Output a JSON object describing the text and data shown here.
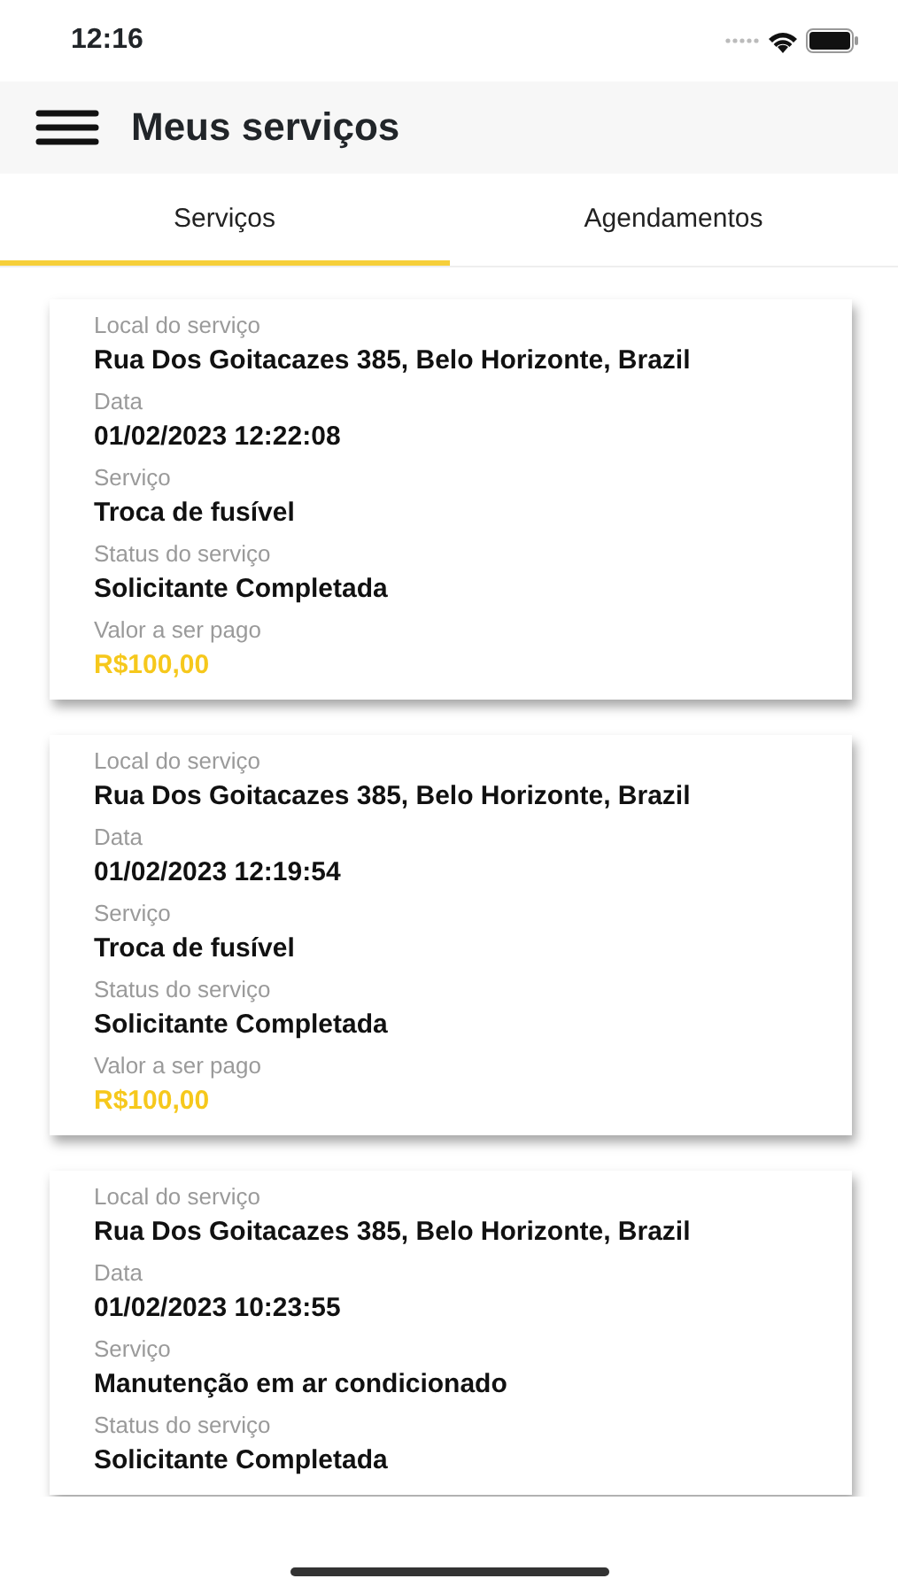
{
  "status_bar": {
    "time": "12:16"
  },
  "header": {
    "title": "Meus serviços"
  },
  "tabs": [
    {
      "label": "Serviços",
      "selected": true
    },
    {
      "label": "Agendamentos",
      "selected": false
    }
  ],
  "services": [
    {
      "fields": [
        {
          "label": "Local do serviço",
          "value": "Rua Dos Goitacazes 385, Belo Horizonte, Brazil",
          "kind": "text"
        },
        {
          "label": "Data",
          "value": "01/02/2023 12:22:08",
          "kind": "text"
        },
        {
          "label": "Serviço",
          "value": "Troca de fusível",
          "kind": "text"
        },
        {
          "label": "Status do serviço",
          "value": "Solicitante Completada",
          "kind": "text"
        },
        {
          "label": "Valor a ser pago",
          "value": "R$100,00",
          "kind": "price"
        }
      ]
    },
    {
      "fields": [
        {
          "label": "Local do serviço",
          "value": "Rua Dos Goitacazes 385, Belo Horizonte, Brazil",
          "kind": "text"
        },
        {
          "label": "Data",
          "value": "01/02/2023 12:19:54",
          "kind": "text"
        },
        {
          "label": "Serviço",
          "value": "Troca de fusível",
          "kind": "text"
        },
        {
          "label": "Status do serviço",
          "value": "Solicitante Completada",
          "kind": "text"
        },
        {
          "label": "Valor a ser pago",
          "value": "R$100,00",
          "kind": "price"
        }
      ]
    },
    {
      "fields": [
        {
          "label": "Local do serviço",
          "value": "Rua Dos Goitacazes 385, Belo Horizonte, Brazil",
          "kind": "text"
        },
        {
          "label": "Data",
          "value": "01/02/2023 10:23:55",
          "kind": "text"
        },
        {
          "label": "Serviço",
          "value": "Manutenção em ar condicionado",
          "kind": "text"
        },
        {
          "label": "Status do serviço",
          "value": "Solicitante Completada",
          "kind": "text"
        }
      ]
    }
  ]
}
